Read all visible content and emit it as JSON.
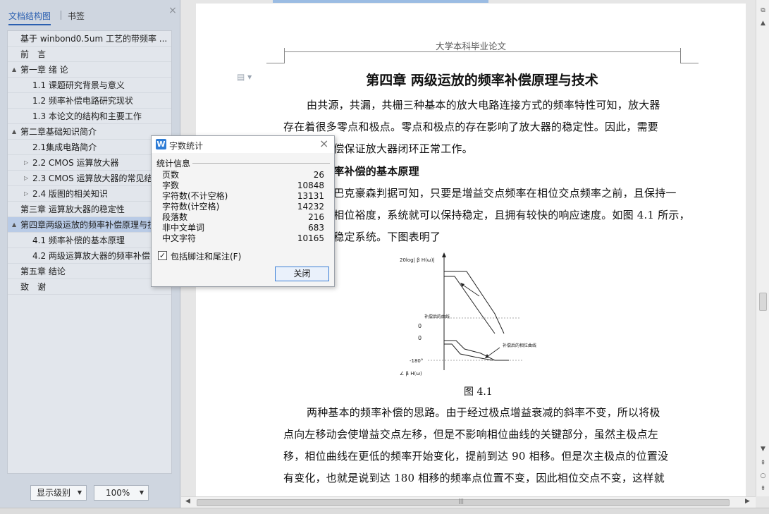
{
  "nav": {
    "tabs": {
      "structure": "文档结构图",
      "bookmark": "书签"
    },
    "close": "×",
    "items": [
      {
        "label": "基于 winbond0.5um 工艺的带频率 ...",
        "level": 1,
        "arrow": ""
      },
      {
        "label": "前　言",
        "level": 1,
        "arrow": ""
      },
      {
        "label": "第一章 绪 论",
        "level": 1,
        "arrow": "▲"
      },
      {
        "label": "1.1 课题研究背景与意义",
        "level": 2,
        "arrow": ""
      },
      {
        "label": "1.2 频率补偿电路研究现状",
        "level": 2,
        "arrow": ""
      },
      {
        "label": "1.3 本论文的结构和主要工作",
        "level": 2,
        "arrow": ""
      },
      {
        "label": "第二章基础知识简介",
        "level": 1,
        "arrow": "▲"
      },
      {
        "label": "2.1集成电路简介",
        "level": 2,
        "arrow": ""
      },
      {
        "label": "2.2 CMOS 运算放大器",
        "level": 2,
        "arrow": "▷"
      },
      {
        "label": "2.3 CMOS 运算放大器的常见结",
        "level": 2,
        "arrow": "▷"
      },
      {
        "label": "2.4 版图的相关知识",
        "level": 2,
        "arrow": "▷"
      },
      {
        "label": "第三章 运算放大器的稳定性",
        "level": 1,
        "arrow": ""
      },
      {
        "label": "第四章两级运放的频率补偿原理与技",
        "level": 1,
        "arrow": "▲",
        "selected": true
      },
      {
        "label": "4.1 频率补偿的基本原理",
        "level": 2,
        "arrow": ""
      },
      {
        "label": "4.2 两级运算放大器的频率补偿",
        "level": 2,
        "arrow": ""
      },
      {
        "label": "第五章 结论",
        "level": 1,
        "arrow": ""
      },
      {
        "label": "致　谢",
        "level": 1,
        "arrow": ""
      }
    ],
    "level_select": "显示级别",
    "zoom_select": "100%"
  },
  "doc": {
    "header": "大学本科毕业论文",
    "chapter_title": "第四章 两级运放的频率补偿原理与技术",
    "lines": [
      "由共源，共漏，共栅三种基本的放大电路连接方式的频率特性可知，放大器",
      "存在着很多零点和极点。零点和极点的存在影响了放大器的稳定性。因此，需要",
      "补偿保证放大器闭环正常工作。",
      "频率补偿的基本原理",
      "由巴克豪森判据可知，只要是增益交点频率在相位交点频率之前，且保持一",
      "的相位裕度，系统就可以保持稳定，且拥有较快的响应速度。如图 4.1 所示，",
      "点稳定系统。下图表明了",
      "两种基本的频率补偿的思路。由于经过极点增益衰减的斜率不变，所以将极",
      "点向左移动会使增益交点左移，但是不影响相位曲线的关键部分，虽然主极点左",
      "移，相位曲线在更低的频率开始变化，提前到达 90 相移。但是次主极点的位置没",
      "有变化，也就是说到达 180 相移的频率点位置不变，因此相位交点不变，这样就"
    ],
    "figure": {
      "y_label": "20log| β H(ω)|",
      "curve_label": "补偿后的曲线",
      "phase_curve_label": "补偿后的相位曲线",
      "zero_gain": "0",
      "zero_phase": "0",
      "minus180": "-180°",
      "phase_label": "∠ β H(ω)"
    },
    "caption": "图 4.1"
  },
  "dialog": {
    "title": "字数统计",
    "close": "×",
    "group_label": "统计信息",
    "stats": [
      {
        "label": "页数",
        "value": "26"
      },
      {
        "label": "字数",
        "value": "10848"
      },
      {
        "label": "字符数(不计空格)",
        "value": "13131"
      },
      {
        "label": "字符数(计空格)",
        "value": "14232"
      },
      {
        "label": "段落数",
        "value": "216"
      },
      {
        "label": "非中文单词",
        "value": "683"
      },
      {
        "label": "中文字符",
        "value": "10165"
      }
    ],
    "checkbox_label": "包括脚注和尾注(F)",
    "checkbox_mark": "✓",
    "close_button": "关闭"
  },
  "colors": {
    "accent": "#2a5fb0",
    "selected_row": "#b9cbe6",
    "dialog_border": "#3c7fd6"
  }
}
